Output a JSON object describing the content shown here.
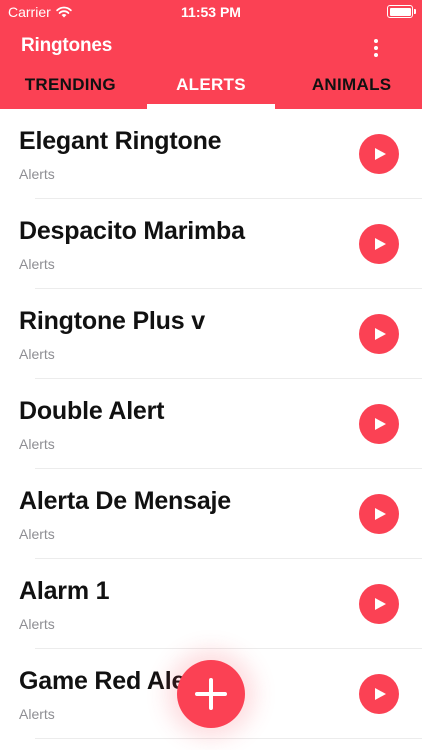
{
  "status_bar": {
    "carrier": "Carrier",
    "time": "11:53 PM"
  },
  "header": {
    "title": "Ringtones",
    "menu_icon": "more-vertical-icon"
  },
  "tabs": [
    {
      "label": "TRENDING",
      "active": false
    },
    {
      "label": "ALERTS",
      "active": true
    },
    {
      "label": "ANIMALS",
      "active": false
    }
  ],
  "items": [
    {
      "title": "Elegant Ringtone",
      "category": "Alerts"
    },
    {
      "title": "Despacito Marimba",
      "category": "Alerts"
    },
    {
      "title": "Ringtone Plus v",
      "category": "Alerts"
    },
    {
      "title": "Double Alert",
      "category": "Alerts"
    },
    {
      "title": "Alerta De Mensaje",
      "category": "Alerts"
    },
    {
      "title": "Alarm 1",
      "category": "Alerts"
    },
    {
      "title": "Game Red Alert",
      "category": "Alerts"
    }
  ],
  "fab": {
    "icon": "plus-icon"
  },
  "colors": {
    "accent": "#fb4154",
    "text": "#111111",
    "subtext": "#8e8e93"
  }
}
